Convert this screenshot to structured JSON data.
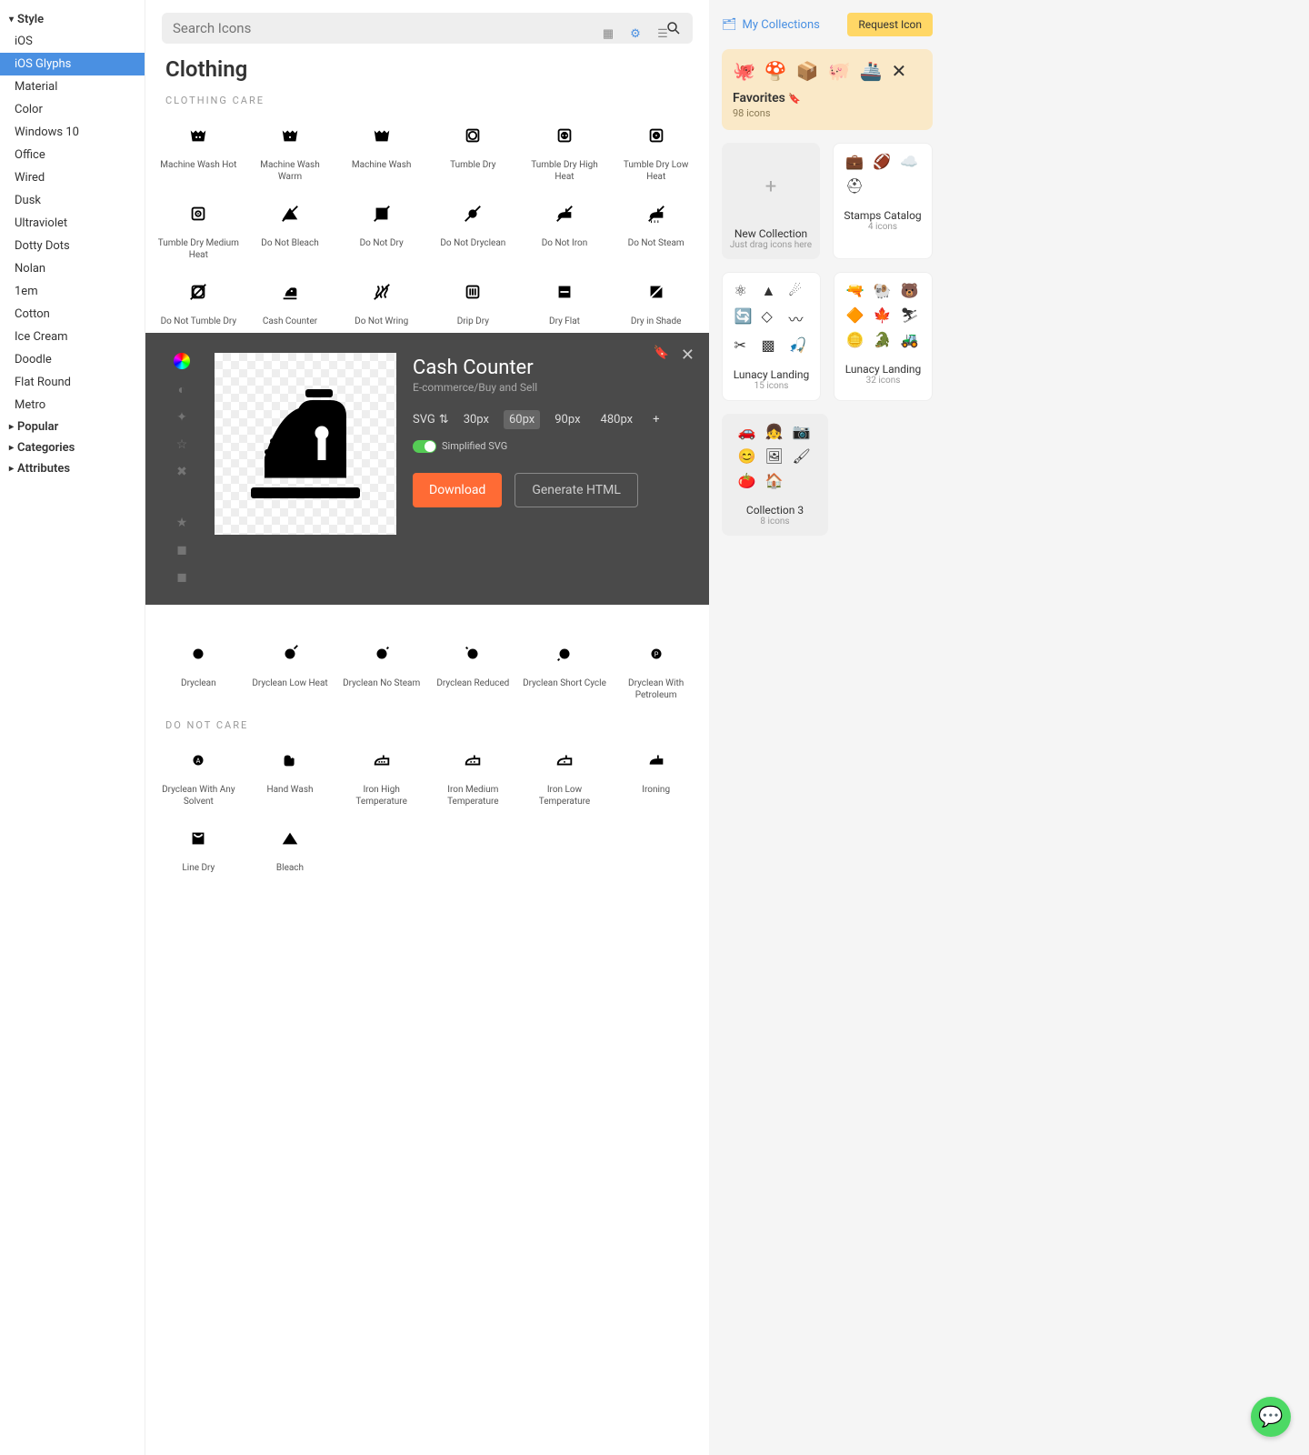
{
  "sidebar": {
    "sections": [
      {
        "label": "Style",
        "expanded": true,
        "items": [
          "iOS",
          "iOS Glyphs",
          "Material",
          "Color",
          "Windows 10",
          "Office",
          "Wired",
          "Dusk",
          "Ultraviolet",
          "Dotty Dots",
          "Nolan",
          "1em",
          "Cotton",
          "Ice Cream",
          "Doodle",
          "Flat Round",
          "Metro"
        ],
        "active": "iOS Glyphs"
      },
      {
        "label": "Popular",
        "expanded": false
      },
      {
        "label": "Categories",
        "expanded": false
      },
      {
        "label": "Attributes",
        "expanded": false
      }
    ]
  },
  "search": {
    "placeholder": "Search Icons"
  },
  "category": {
    "title": "Clothing"
  },
  "groups": [
    {
      "title": "Clothing Care",
      "icons": [
        {
          "name": "Machine Wash Hot"
        },
        {
          "name": "Machine Wash Warm"
        },
        {
          "name": "Machine Wash"
        },
        {
          "name": "Tumble Dry"
        },
        {
          "name": "Tumble Dry High Heat"
        },
        {
          "name": "Tumble Dry Low Heat"
        },
        {
          "name": "Tumble Dry Medium Heat"
        },
        {
          "name": "Do Not Bleach"
        },
        {
          "name": "Do Not Dry"
        },
        {
          "name": "Do Not Dryclean"
        },
        {
          "name": "Do Not Iron"
        },
        {
          "name": "Do Not Steam"
        },
        {
          "name": "Do Not Tumble Dry"
        },
        {
          "name": "Cash Counter"
        },
        {
          "name": "Do Not Wring"
        },
        {
          "name": "Drip Dry"
        },
        {
          "name": "Dry Flat"
        },
        {
          "name": "Dry in Shade"
        }
      ]
    },
    {
      "title": "",
      "icons": [
        {
          "name": "Dryclean"
        },
        {
          "name": "Dryclean Low Heat"
        },
        {
          "name": "Dryclean No Steam"
        },
        {
          "name": "Dryclean Reduced"
        },
        {
          "name": "Dryclean Short Cycle"
        },
        {
          "name": "Dryclean With Petroleum"
        }
      ]
    },
    {
      "title": "Do Not Care",
      "icons": [
        {
          "name": "Dryclean With Any Solvent"
        },
        {
          "name": "Hand Wash"
        },
        {
          "name": "Iron High Temperature"
        },
        {
          "name": "Iron Medium Temperature"
        },
        {
          "name": "Iron Low Temperature"
        },
        {
          "name": "Ironing"
        },
        {
          "name": "Line Dry"
        },
        {
          "name": "Bleach"
        }
      ]
    }
  ],
  "detail": {
    "title": "Cash Counter",
    "breadcrumb": "E-commerce/Buy and Sell",
    "format": "SVG",
    "sizes": [
      "30px",
      "60px",
      "90px",
      "480px"
    ],
    "activeSize": "60px",
    "simplified": "Simplified SVG",
    "download": "Download",
    "generate": "Generate HTML"
  },
  "right": {
    "mycollections": "My Collections",
    "request": "Request Icon",
    "favorites": {
      "title": "Favorites",
      "count": "98 icons"
    },
    "collections": [
      {
        "title": "New Collection",
        "sub": "Just drag icons here",
        "type": "new"
      },
      {
        "title": "Stamps Catalog",
        "sub": "4 icons",
        "icons": [
          "briefcase",
          "football",
          "cloud",
          "helmet"
        ]
      },
      {
        "title": "Lunacy Landing",
        "sub": "15 icons",
        "icons": [
          "atom",
          "tri",
          "comet",
          "cycle",
          "diamond",
          "hook",
          "crop",
          "checker",
          "fishhook"
        ]
      },
      {
        "title": "Lunacy Landing",
        "sub": "32 icons",
        "icons": [
          "gun",
          "ram",
          "bear",
          "super",
          "leaf",
          "ski",
          "coin",
          "croc",
          "tank"
        ]
      },
      {
        "title": "Collection 3",
        "sub": "8 icons",
        "icons": [
          "car",
          "girl",
          "camera",
          "emoji",
          "pic",
          "brush",
          "tomato",
          "house"
        ]
      }
    ]
  }
}
